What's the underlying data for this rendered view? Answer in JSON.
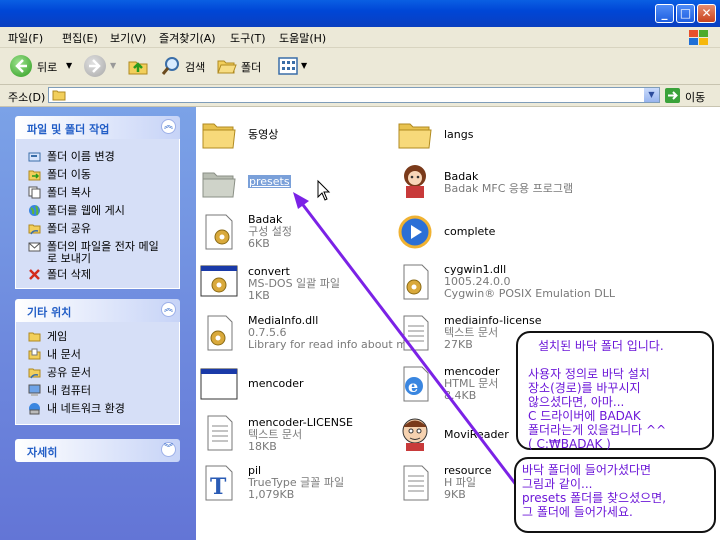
{
  "window": {
    "minimize": "_",
    "maximize": "□",
    "close": "✕"
  },
  "menu": [
    "파일(F)",
    "편집(E)",
    "보기(V)",
    "즐겨찾기(A)",
    "도구(T)",
    "도움말(H)"
  ],
  "toolbar": {
    "back_label": "뒤로",
    "search_label": "검색",
    "folders_label": "폴더"
  },
  "address": {
    "label": "주소(D)",
    "value": "",
    "go_label": "이동"
  },
  "file_tasks": {
    "title": "파일 및 폴더 작업",
    "items": [
      {
        "label": "폴더 이름 변경",
        "icon": "rename-icon"
      },
      {
        "label": "폴더 이동",
        "icon": "move-icon"
      },
      {
        "label": "폴더 복사",
        "icon": "copy-icon"
      },
      {
        "label": "폴더를 웹에 게시",
        "icon": "web-publish-icon"
      },
      {
        "label": "폴더 공유",
        "icon": "share-icon"
      },
      {
        "label_line1": "폴더의 파일을 전자 메일",
        "label_line2": "로 보내기",
        "icon": "email-icon"
      },
      {
        "label": "폴더 삭제",
        "icon": "delete-icon"
      }
    ]
  },
  "other_places": {
    "title": "기타 위치",
    "items": [
      {
        "label": "게임",
        "icon": "folder-icon"
      },
      {
        "label": "내 문서",
        "icon": "my-documents-icon"
      },
      {
        "label": "공유 문서",
        "icon": "shared-documents-icon"
      },
      {
        "label": "내 컴퓨터",
        "icon": "my-computer-icon"
      },
      {
        "label": "내 네트워크 환경",
        "icon": "network-icon"
      }
    ]
  },
  "details": {
    "title": "자세히"
  },
  "files_left": [
    {
      "name": "동영상",
      "line2": "",
      "line3": "",
      "icon": "folder-icon"
    },
    {
      "name": "presets",
      "line2": "",
      "line3": "",
      "icon": "folder-icon"
    },
    {
      "name": "Badak",
      "line2": "구성 설정",
      "line3": "6KB",
      "icon": "config-icon"
    },
    {
      "name": "convert",
      "line2": "MS-DOS 일괄 파일",
      "line3": "1KB",
      "icon": "batch-icon"
    },
    {
      "name": "MediaInfo.dll",
      "line2": "0.7.5.6",
      "line3": "Library for read info about me...",
      "icon": "dll-icon"
    },
    {
      "name": "mencoder",
      "line2": "",
      "line3": "",
      "icon": "exe-icon"
    },
    {
      "name": "mencoder-LICENSE",
      "line2": "텍스트 문서",
      "line3": "18KB",
      "icon": "text-icon"
    },
    {
      "name": "pil",
      "line2": "TrueType 글꼴 파일",
      "line3": "1,079KB",
      "icon": "font-icon"
    }
  ],
  "files_right": [
    {
      "name": "langs",
      "line2": "",
      "line3": "",
      "icon": "folder-icon"
    },
    {
      "name": "Badak",
      "line2": "Badak MFC 응용 프로그램",
      "line3": "",
      "icon": "badak-app-icon"
    },
    {
      "name": "complete",
      "line2": "",
      "line3": "",
      "icon": "media-player-icon"
    },
    {
      "name": "cygwin1.dll",
      "line2": "1005.24.0.0",
      "line3": "Cygwin® POSIX Emulation DLL",
      "icon": "dll-icon"
    },
    {
      "name": "mediainfo-license",
      "line2": "텍스트 문서",
      "line3": "27KB",
      "icon": "text-icon"
    },
    {
      "name": "mencoder",
      "line2": "HTML 문서",
      "line3": "8.4KB",
      "icon": "ie-icon"
    },
    {
      "name": "MoviReader",
      "line2": "",
      "line3": "",
      "icon": "character-icon"
    },
    {
      "name": "resource",
      "line2": "H 파일",
      "line3": "9KB",
      "icon": "text-icon"
    }
  ],
  "callout_top": {
    "line1": "설치된 바닥 폴더 입니다.",
    "line2": "사용자 정의로 바닥 설치",
    "line3": "장소(경로)를 바꾸시지",
    "line4": "않으셨다면, 아마...",
    "line5": "C 드라이버에 BADAK",
    "line6": "폴더라는게 있을겁니다 ^^",
    "line7": "( C:₩BADAK )"
  },
  "callout_bottom": {
    "line1": "바닥 폴더에 들어가셨다면",
    "line2": "그림과 같이...",
    "line3": "presets 폴더를 찾으셨으면,",
    "line4": "그 폴더에 들어가세요."
  },
  "colors": {
    "accent": "#215dc6",
    "annotation": "#6c17d8",
    "folder": "#f5d36a",
    "titlebar": "#0054e3"
  }
}
